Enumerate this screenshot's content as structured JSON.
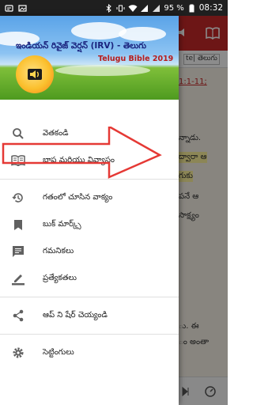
{
  "status_bar": {
    "battery": "95 %",
    "time": "08:32"
  },
  "drawer": {
    "header_title": "ఇండియన్ రివైజ్ వెర్షన్ (IRV) - తెలుగు",
    "header_subtitle": "Telugu Bible 2019",
    "items": [
      {
        "label": "వెతకండి",
        "icon": "search-icon"
      },
      {
        "label": "భాష మరియు వివ్యాసం",
        "icon": "book-icon"
      },
      {
        "label": "గతంలో చూసిన వాక్యం",
        "icon": "history-icon"
      },
      {
        "label": "బుక్ మార్క్స్",
        "icon": "bookmark-icon"
      },
      {
        "label": "గమనికలు",
        "icon": "notes-icon"
      },
      {
        "label": "ప్రత్యేకతలు",
        "icon": "highlight-icon"
      },
      {
        "label": "ఆప్ ని షేర్ చెయ్యండి",
        "icon": "share-icon"
      },
      {
        "label": "సెట్టింగులు",
        "icon": "settings-icon"
      }
    ]
  },
  "background_app": {
    "language_chip": "te| తెలుగు",
    "reference": "1:1-11;",
    "text_lines": [
      "న్నాడు.",
      "ద్వారా ఆ",
      "గుకు",
      "పనే ఆ",
      "సాక్ష్యం",
      "ు. ఈ",
      "ం అంతా"
    ]
  },
  "colors": {
    "app_bar": "#c62828",
    "scrim": "rgba(0,0,0,0.45)",
    "annotation_arrow": "#e53935"
  }
}
